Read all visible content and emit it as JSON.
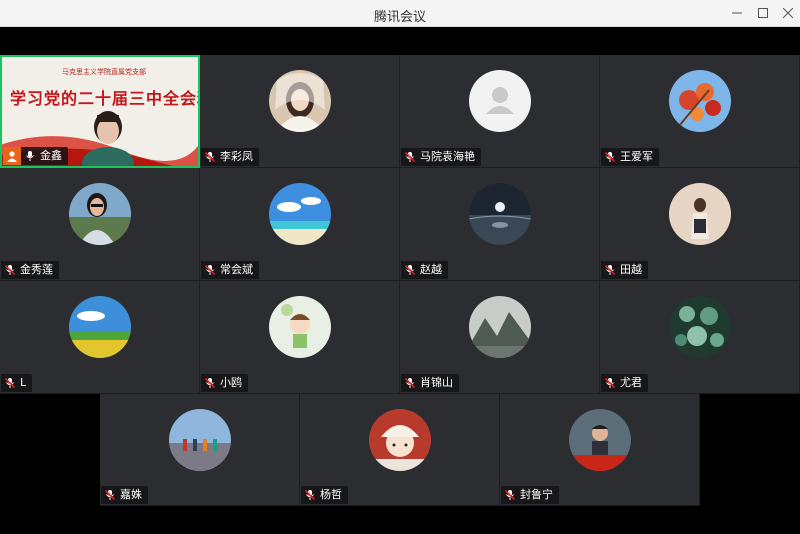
{
  "window": {
    "title": "腾讯会议",
    "minimize_icon": "minimize-icon",
    "maximize_icon": "maximize-icon",
    "close_icon": "close-icon"
  },
  "speaker": {
    "name": "金鑫",
    "banner_small": "马克思主义学院直属党支部",
    "banner_big": "学习党的二十届三中全会精神"
  },
  "participants": [
    {
      "name": "李彩凤",
      "avatar": "bride-portrait"
    },
    {
      "name": "马院袁海艳",
      "avatar": "default-person"
    },
    {
      "name": "王爱军",
      "avatar": "red-leaves-sky"
    },
    {
      "name": "金秀莲",
      "avatar": "woman-sunglasses"
    },
    {
      "name": "常会斌",
      "avatar": "beach-sky"
    },
    {
      "name": "赵越",
      "avatar": "night-lake-moon"
    },
    {
      "name": "田越",
      "avatar": "girl-backpack"
    },
    {
      "name": "L",
      "avatar": "grass-sky"
    },
    {
      "name": "小鸥",
      "avatar": "cartoon-kid"
    },
    {
      "name": "肖锦山",
      "avatar": "misty-mountains"
    },
    {
      "name": "尤君",
      "avatar": "succulents"
    },
    {
      "name": "嘉姝",
      "avatar": "people-sand"
    },
    {
      "name": "杨哲",
      "avatar": "cartoon-girl-hat"
    },
    {
      "name": "封鲁宁",
      "avatar": "boy-red-banner"
    }
  ],
  "colors": {
    "speaker_border": "#1bc45c",
    "tile_bg": "#2b2d30",
    "mic_muted": "#e02020",
    "user_badge": "#e8641b"
  }
}
